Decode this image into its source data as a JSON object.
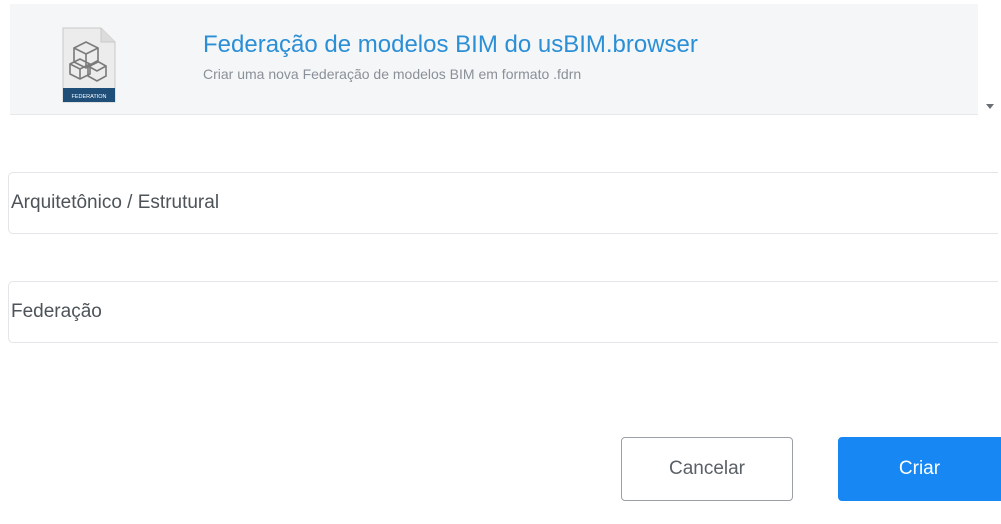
{
  "template": {
    "title": "Federação de modelos BIM do usBIM.browser",
    "subtitle": "Criar uma nova Federação de modelos BIM em formato .fdrn",
    "icon": "federation-file-icon",
    "icon_badge": "FEDERATION"
  },
  "fields": {
    "category_value": "Arquitetônico / Estrutural",
    "name_value": "Federação"
  },
  "actions": {
    "cancel_label": "Cancelar",
    "create_label": "Criar"
  },
  "colors": {
    "accent": "#1687f3",
    "title_link": "#2b8fd6",
    "panel_bg": "#f5f6f8"
  }
}
